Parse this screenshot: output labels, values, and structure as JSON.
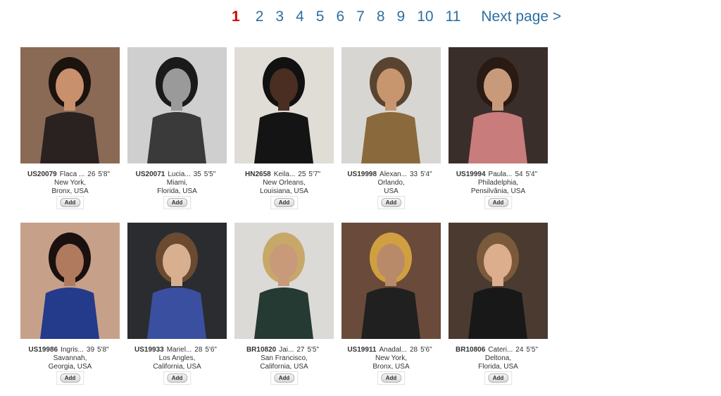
{
  "pagination": {
    "pages": [
      "1",
      "2",
      "3",
      "4",
      "5",
      "6",
      "7",
      "8",
      "9",
      "10",
      "11"
    ],
    "current": "1",
    "next_label": "Next page >"
  },
  "profiles": [
    {
      "code": "US20079",
      "name": "Flaca ...",
      "age": "26",
      "height": "5'8\"",
      "city": "New York,",
      "region": "Bronx, USA",
      "add_label": "Add",
      "colors": {
        "bg": "#8a6a55",
        "hair": "#1c120e",
        "skin": "#c9906e",
        "cloth": "#2a2220"
      }
    },
    {
      "code": "US20071",
      "name": "Lucia...",
      "age": "35",
      "height": "5'5\"",
      "city": "Miami,",
      "region": "Florida, USA",
      "add_label": "Add",
      "colors": {
        "bg": "#cfcfcf",
        "hair": "#1a1a1a",
        "skin": "#9a9a9a",
        "cloth": "#3a3a3a"
      }
    },
    {
      "code": "HN2658",
      "name": "Keila...",
      "age": "25",
      "height": "5'7\"",
      "city": "New Orleans,",
      "region": "Louisiana, USA",
      "add_label": "Add",
      "colors": {
        "bg": "#e0ddd6",
        "hair": "#111111",
        "skin": "#4a2e22",
        "cloth": "#141414"
      }
    },
    {
      "code": "US19998",
      "name": "Alexan...",
      "age": "33",
      "height": "5'4\"",
      "city": "Orlando,",
      "region": "USA",
      "add_label": "Add",
      "colors": {
        "bg": "#d8d6d2",
        "hair": "#5a4430",
        "skin": "#c8966e",
        "cloth": "#8a6a3c"
      }
    },
    {
      "code": "US19994",
      "name": "Paula...",
      "age": "54",
      "height": "5'4\"",
      "city": "Philadelphia,",
      "region": "Pensilvânia, USA",
      "add_label": "Add",
      "colors": {
        "bg": "#3a2e2a",
        "hair": "#2a1a14",
        "skin": "#c89a7a",
        "cloth": "#c87c7c"
      }
    },
    {
      "code": "US19986",
      "name": "Ingris...",
      "age": "39",
      "height": "5'8\"",
      "city": "Savannah,",
      "region": "Georgia, USA",
      "add_label": "Add",
      "colors": {
        "bg": "#c7a08a",
        "hair": "#1a1010",
        "skin": "#b07a5e",
        "cloth": "#243a8a"
      }
    },
    {
      "code": "US19933",
      "name": "Mariel...",
      "age": "28",
      "height": "5'6\"",
      "city": "Los Angles,",
      "region": "California, USA",
      "add_label": "Add",
      "colors": {
        "bg": "#2a2c30",
        "hair": "#6a4a30",
        "skin": "#d8b090",
        "cloth": "#3b4fa0"
      }
    },
    {
      "code": "BR10820",
      "name": "Jai...",
      "age": "27",
      "height": "5'5\"",
      "city": "San Francisco,",
      "region": "California, USA",
      "add_label": "Add",
      "colors": {
        "bg": "#dcdad6",
        "hair": "#c8a868",
        "skin": "#c89a7a",
        "cloth": "#243a32"
      }
    },
    {
      "code": "US19911",
      "name": "Anadal...",
      "age": "28",
      "height": "5'6\"",
      "city": "New York,",
      "region": "Bronx, USA",
      "add_label": "Add",
      "colors": {
        "bg": "#6a4a3a",
        "hair": "#d0a040",
        "skin": "#b88a6a",
        "cloth": "#202020"
      }
    },
    {
      "code": "BR10806",
      "name": "Cateri...",
      "age": "24",
      "height": "5'5\"",
      "city": "Deltona,",
      "region": "Florida, USA",
      "add_label": "Add",
      "colors": {
        "bg": "#4a3a30",
        "hair": "#7a5a3a",
        "skin": "#dcae8e",
        "cloth": "#181818"
      }
    }
  ]
}
